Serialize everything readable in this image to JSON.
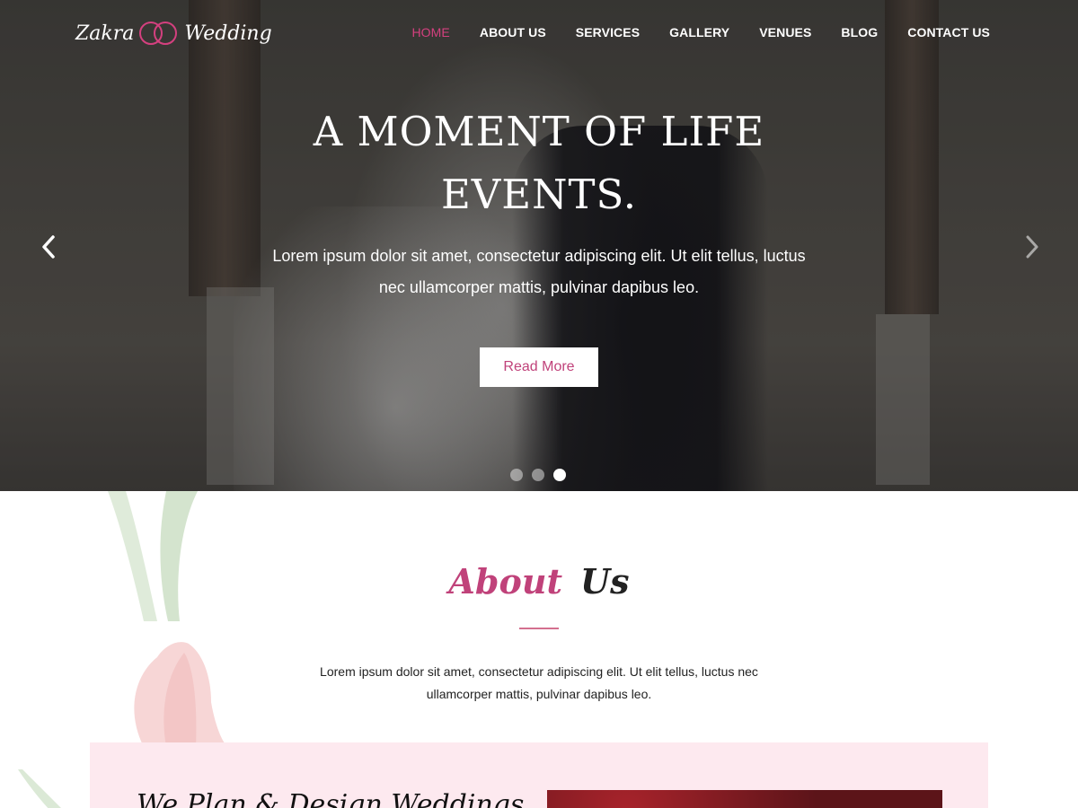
{
  "header": {
    "logo": {
      "left": "Zakra",
      "right": "Wedding"
    },
    "nav": [
      {
        "label": "HOME",
        "active": true
      },
      {
        "label": "ABOUT US",
        "active": false
      },
      {
        "label": "SERVICES",
        "active": false
      },
      {
        "label": "GALLERY",
        "active": false
      },
      {
        "label": "VENUES",
        "active": false
      },
      {
        "label": "BLOG",
        "active": false
      },
      {
        "label": "CONTACT US",
        "active": false
      }
    ]
  },
  "hero": {
    "title_line1": "A MOMENT OF LIFE",
    "title_line2": "EVENTS.",
    "text": "Lorem ipsum dolor sit amet, consectetur adipiscing elit. Ut elit tellus, luctus nec ullamcorper mattis, pulvinar dapibus leo.",
    "button_label": "Read More",
    "slides_total": 3,
    "active_slide": 3,
    "prev_icon": "chevron-left-icon",
    "next_icon": "chevron-right-icon"
  },
  "about": {
    "title_part1": "About",
    "title_part2": "Us",
    "text": "Lorem ipsum dolor sit amet, consectetur adipiscing elit. Ut elit tellus, luctus nec ullamcorper mattis, pulvinar dapibus leo.",
    "plan_title": "We Plan & Design Weddings"
  },
  "colors": {
    "accent": "#d4407f",
    "card_bg": "#fde9ef"
  }
}
